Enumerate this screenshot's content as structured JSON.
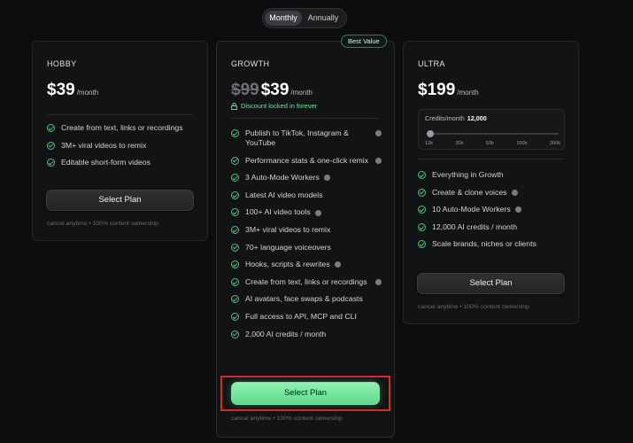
{
  "billing_toggle": {
    "monthly": "Monthly",
    "annually": "Annually",
    "selected": "Monthly"
  },
  "colors": {
    "accent_green": "#6ee79b",
    "button_green": "#74e6a0",
    "highlight_red": "#d42a2a",
    "background": "#0c0d0e"
  },
  "plans": {
    "hobby": {
      "name": "HOBBY",
      "price": "$39",
      "per": "/month",
      "features": [
        {
          "text": "Create from text, links or recordings",
          "info": false
        },
        {
          "text": "3M+ viral videos to remix",
          "info": false
        },
        {
          "text": "Editable short-form videos",
          "info": false
        }
      ],
      "cta": "Select Plan",
      "fine_print": "cancel anytime • 100% content ownership"
    },
    "growth": {
      "name": "GROWTH",
      "badge": "Best Value",
      "old_price": "$99",
      "price": "$39",
      "per": "/month",
      "discount_note": "Discount locked in forever",
      "features": [
        {
          "text": "Publish to TikTok, Instagram & YouTube",
          "info": true
        },
        {
          "text": "Performance stats & one-click remix",
          "info": true
        },
        {
          "text": "3 Auto-Mode Workers",
          "info": true
        },
        {
          "text": "Latest AI video models",
          "info": false
        },
        {
          "text": "100+ AI video tools",
          "info": true
        },
        {
          "text": "3M+ viral videos to remix",
          "info": false
        },
        {
          "text": "70+ language voiceovers",
          "info": false
        },
        {
          "text": "Hooks, scripts & rewrites",
          "info": true
        },
        {
          "text": "Create from text, links or recordings",
          "info": true
        },
        {
          "text": "AI avatars, face swaps & podcasts",
          "info": false
        },
        {
          "text": "Full access to API, MCP and CLI",
          "info": false
        },
        {
          "text": "2,000 AI credits / month",
          "info": false
        }
      ],
      "cta": "Select Plan",
      "fine_print": "cancel anytime • 100% content ownership"
    },
    "ultra": {
      "name": "ULTRA",
      "price": "$199",
      "per": "/month",
      "credits": {
        "label": "Credits/month",
        "value": "12,000",
        "ticks": [
          "12k",
          "30k",
          "50k",
          "100k",
          "200k"
        ],
        "selected_index": 0
      },
      "features": [
        {
          "text": "Everything in Growth",
          "info": false
        },
        {
          "text": "Create & clone voices",
          "info": true
        },
        {
          "text": "10 Auto-Mode Workers",
          "info": true
        },
        {
          "text": "12,000 AI credits / month",
          "info": false
        },
        {
          "text": "Scale brands, niches or clients",
          "info": false
        }
      ],
      "cta": "Select Plan",
      "fine_print": "cancel anytime • 100% content ownership"
    }
  }
}
